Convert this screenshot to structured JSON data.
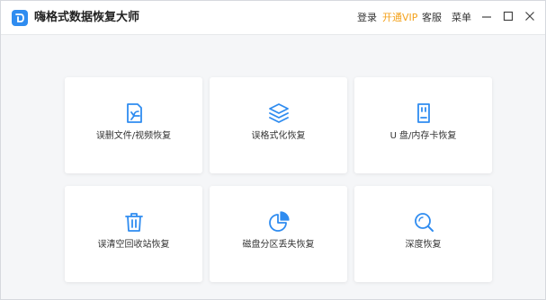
{
  "app": {
    "title": "嗨格式数据恢复大师"
  },
  "menu": {
    "login": "登录",
    "vip": "开通VIP",
    "service": "客服",
    "menu": "菜单"
  },
  "cards": [
    {
      "label": "误删文件/视频恢复",
      "icon": "file-restore-icon"
    },
    {
      "label": "误格式化恢复",
      "icon": "layers-icon"
    },
    {
      "label": "U 盘/内存卡恢复",
      "icon": "usb-drive-icon"
    },
    {
      "label": "误清空回收站恢复",
      "icon": "trash-icon"
    },
    {
      "label": "磁盘分区丢失恢复",
      "icon": "pie-chart-icon"
    },
    {
      "label": "深度恢复",
      "icon": "search-icon"
    }
  ],
  "colors": {
    "accent": "#2f8cf0",
    "vip": "#f4a21c",
    "background": "#f5f6f8"
  }
}
